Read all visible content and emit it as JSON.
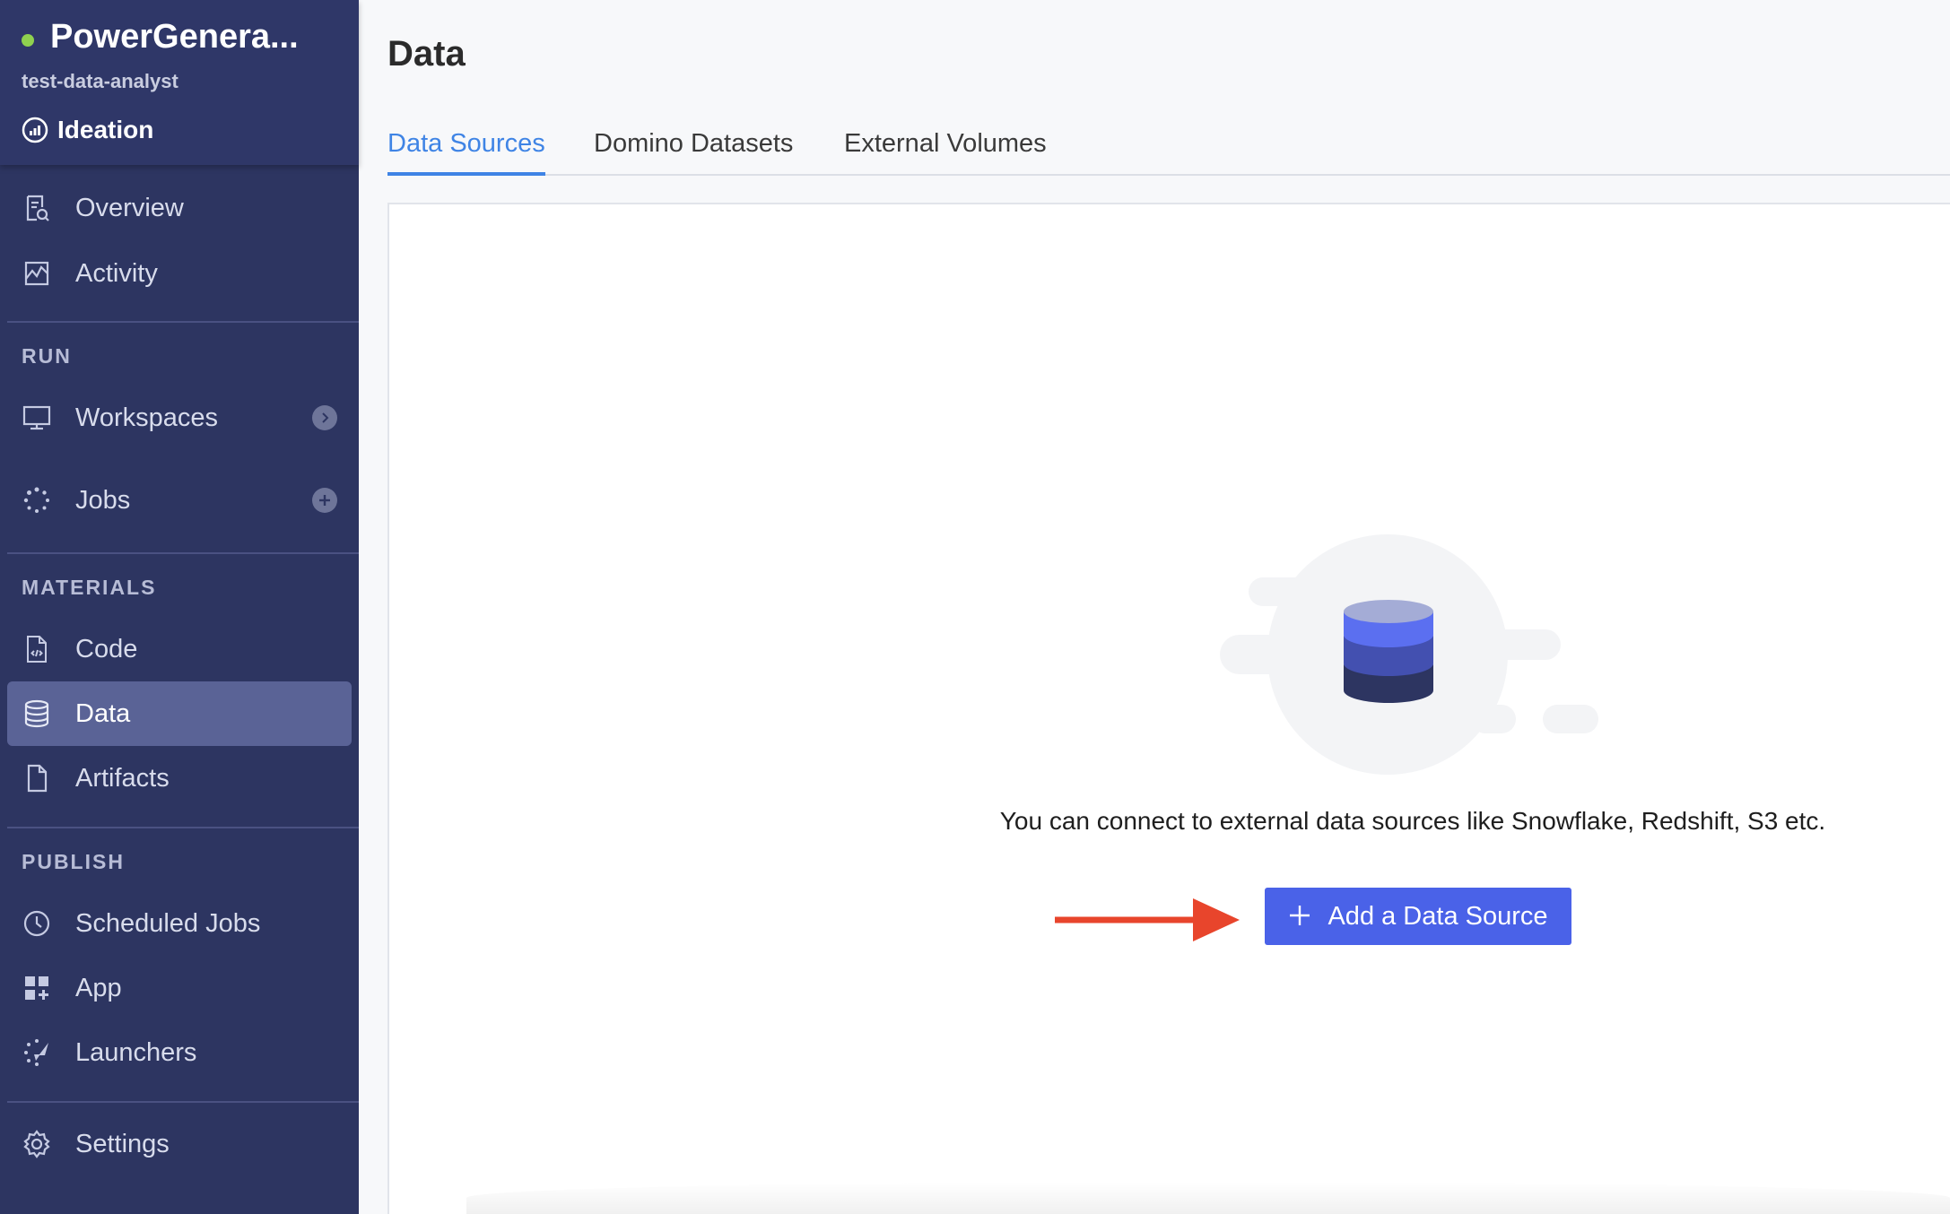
{
  "project": {
    "name": "PowerGenera...",
    "owner": "test-data-analyst",
    "stage": "Ideation",
    "status_color": "#8fd14f"
  },
  "sidebar": {
    "top_items": [
      {
        "label": "Overview",
        "icon": "overview-icon"
      },
      {
        "label": "Activity",
        "icon": "activity-icon"
      }
    ],
    "sections": [
      {
        "title": "RUN",
        "items": [
          {
            "label": "Workspaces",
            "icon": "monitor-icon",
            "action": "chevron-right-icon"
          },
          {
            "label": "Jobs",
            "icon": "jobs-icon",
            "action": "plus-icon"
          }
        ]
      },
      {
        "title": "MATERIALS",
        "items": [
          {
            "label": "Code",
            "icon": "code-file-icon"
          },
          {
            "label": "Data",
            "icon": "database-icon",
            "active": true
          },
          {
            "label": "Artifacts",
            "icon": "file-icon"
          }
        ]
      },
      {
        "title": "PUBLISH",
        "items": [
          {
            "label": "Scheduled Jobs",
            "icon": "clock-icon"
          },
          {
            "label": "App",
            "icon": "app-grid-icon"
          },
          {
            "label": "Launchers",
            "icon": "launcher-icon"
          }
        ]
      }
    ],
    "bottom_items": [
      {
        "label": "Settings",
        "icon": "gear-icon"
      }
    ]
  },
  "main": {
    "title": "Data",
    "tabs": [
      {
        "label": "Data Sources",
        "active": true
      },
      {
        "label": "Domino Datasets"
      },
      {
        "label": "External Volumes"
      }
    ],
    "empty_state": {
      "message": "You can connect to external data sources like Snowflake, Redshift, S3 etc.",
      "button_label": "Add a Data Source",
      "illustration": "database-illustration"
    }
  },
  "colors": {
    "sidebar_bg": "#2d3561",
    "accent_blue": "#3f84e5",
    "button_blue": "#4a62e8",
    "arrow_red": "#e8452c"
  }
}
